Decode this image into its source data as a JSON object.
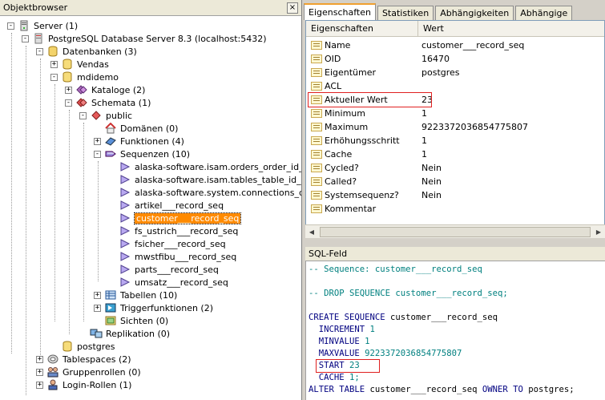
{
  "left": {
    "title": "Objektbrowser",
    "close": "×",
    "tree": [
      {
        "label": "Server (1)",
        "icon": "server-icon",
        "exp": "-"
      },
      {
        "label": "PostgreSQL Database Server 8.3 (localhost:5432)",
        "icon": "db-server-icon",
        "exp": "-"
      },
      {
        "label": "Datenbanken (3)",
        "icon": "databases-icon",
        "exp": "-"
      },
      {
        "label": "Vendas",
        "icon": "database-icon",
        "exp": "+"
      },
      {
        "label": "mdidemo",
        "icon": "database-icon",
        "exp": "-"
      },
      {
        "label": "Kataloge (2)",
        "icon": "catalog-icon",
        "exp": "+"
      },
      {
        "label": "Schemata (1)",
        "icon": "schemas-icon",
        "exp": "-"
      },
      {
        "label": "public",
        "icon": "schema-icon",
        "exp": "-"
      },
      {
        "label": "Domänen (0)",
        "icon": "domain-icon",
        "exp": ""
      },
      {
        "label": "Funktionen (4)",
        "icon": "function-icon",
        "exp": "+"
      },
      {
        "label": "Sequenzen (10)",
        "icon": "sequences-icon",
        "exp": "-"
      },
      {
        "label": "alaska-software.isam.orders_order_id_seq",
        "icon": "sequence-icon",
        "exp": ""
      },
      {
        "label": "alaska-software.isam.tables_table_id_seq",
        "icon": "sequence-icon",
        "exp": ""
      },
      {
        "label": "alaska-software.system.connections_connect",
        "icon": "sequence-icon",
        "exp": ""
      },
      {
        "label": "artikel___record_seq",
        "icon": "sequence-icon",
        "exp": ""
      },
      {
        "label": "customer___record_seq",
        "icon": "sequence-icon",
        "exp": "",
        "selected": true
      },
      {
        "label": "fs_ustrich___record_seq",
        "icon": "sequence-icon",
        "exp": ""
      },
      {
        "label": "fsicher___record_seq",
        "icon": "sequence-icon",
        "exp": ""
      },
      {
        "label": "mwstfibu___record_seq",
        "icon": "sequence-icon",
        "exp": ""
      },
      {
        "label": "parts___record_seq",
        "icon": "sequence-icon",
        "exp": ""
      },
      {
        "label": "umsatz___record_seq",
        "icon": "sequence-icon",
        "exp": ""
      },
      {
        "label": "Tabellen (10)",
        "icon": "tables-icon",
        "exp": "+"
      },
      {
        "label": "Triggerfunktionen (2)",
        "icon": "trigger-icon",
        "exp": "+"
      },
      {
        "label": "Sichten (0)",
        "icon": "views-icon",
        "exp": ""
      },
      {
        "label": "Replikation (0)",
        "icon": "replication-icon",
        "exp": ""
      },
      {
        "label": "postgres",
        "icon": "database-icon",
        "exp": ""
      },
      {
        "label": "Tablespaces (2)",
        "icon": "tablespaces-icon",
        "exp": "+"
      },
      {
        "label": "Gruppenrollen (0)",
        "icon": "group-roles-icon",
        "exp": "+"
      },
      {
        "label": "Login-Rollen (1)",
        "icon": "login-roles-icon",
        "exp": "+"
      }
    ]
  },
  "right": {
    "tabs": [
      "Eigenschaften",
      "Statistiken",
      "Abhängigkeiten",
      "Abhängige"
    ],
    "active_tab": "Eigenschaften",
    "props_header": {
      "name": "Eigenschaften",
      "value": "Wert"
    },
    "props": [
      {
        "name": "Name",
        "value": "customer___record_seq"
      },
      {
        "name": "OID",
        "value": "16470"
      },
      {
        "name": "Eigentümer",
        "value": "postgres"
      },
      {
        "name": "ACL",
        "value": ""
      },
      {
        "name": "Aktueller Wert",
        "value": "23",
        "highlight": true
      },
      {
        "name": "Minimum",
        "value": "1"
      },
      {
        "name": "Maximum",
        "value": "9223372036854775807"
      },
      {
        "name": "Erhöhungsschritt",
        "value": "1"
      },
      {
        "name": "Cache",
        "value": "1"
      },
      {
        "name": "Cycled?",
        "value": "Nein"
      },
      {
        "name": "Called?",
        "value": "Nein"
      },
      {
        "name": "Systemsequenz?",
        "value": "Nein"
      },
      {
        "name": "Kommentar",
        "value": ""
      }
    ],
    "sql_title": "SQL-Feld",
    "sql": {
      "c1": "-- Sequence: customer___record_seq",
      "c2": "-- DROP SEQUENCE customer___record_seq;",
      "create_kw": "CREATE SEQUENCE",
      "create_name": " customer___record_seq",
      "inc_kw": "  INCREMENT",
      "inc_val": " 1",
      "min_kw": "  MINVALUE",
      "min_val": " 1",
      "max_kw": "  MAXVALUE",
      "max_val": " 9223372036854775807",
      "start_kw": "  START",
      "start_val": " 23",
      "cache_kw": "  CACHE",
      "cache_val": " 1;",
      "alter_kw": "ALTER TABLE",
      "alter_name": " customer___record_seq ",
      "owner_kw": "OWNER TO",
      "owner_val": " postgres;"
    },
    "colors": {
      "comment": "#00807f",
      "keyword": "#000080",
      "number": "#008080",
      "selection": "#ff8a00",
      "highlight": "#e02020"
    }
  }
}
